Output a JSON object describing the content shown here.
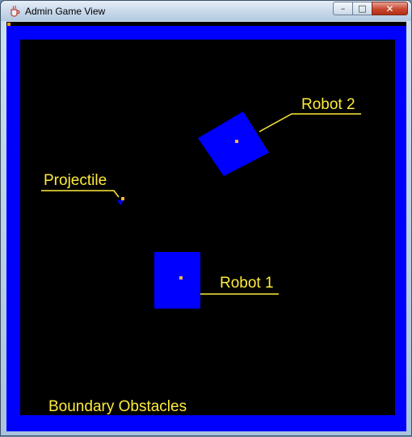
{
  "window": {
    "title": "Admin Game View",
    "controls": {
      "minimize": "–",
      "maximize": "□",
      "close": "✕"
    }
  },
  "scene": {
    "colors": {
      "arena_wall": "#0000ff",
      "field": "#000000",
      "robot": "#0000ff",
      "center_marker": "#ffb347",
      "label": "#ffeb3b"
    },
    "labels": {
      "robot1": "Robot 1",
      "robot2": "Robot 2",
      "projectile": "Projectile",
      "boundary": "Boundary Obstacles"
    }
  }
}
